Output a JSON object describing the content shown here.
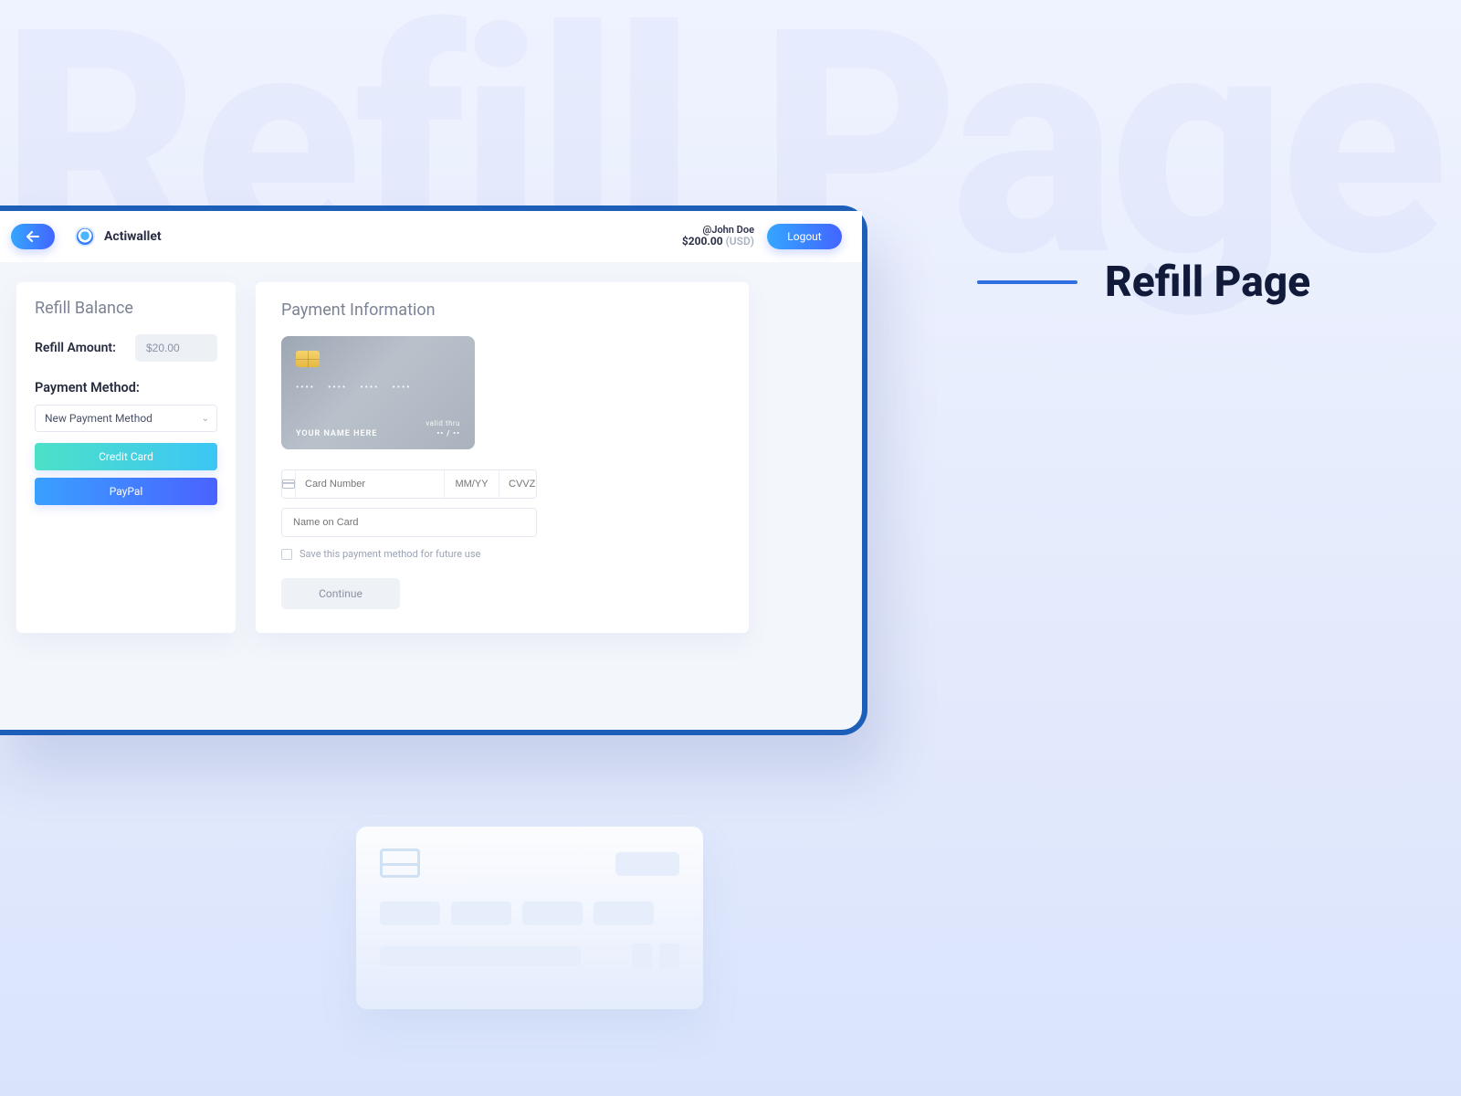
{
  "page": {
    "watermark": "Refill Page",
    "title": "Refill Page"
  },
  "header": {
    "brand": "Actiwallet",
    "user_handle": "@John Doe",
    "balance_amount": "$200.00",
    "balance_currency": "(USD)",
    "logout_label": "Logout"
  },
  "refill": {
    "card_title": "Refill Balance",
    "amount_label": "Refill Amount:",
    "amount_value": "$20.00",
    "method_label": "Payment Method:",
    "select_value": "New Payment Method",
    "credit_card_label": "Credit Card",
    "paypal_label": "PayPal"
  },
  "payment": {
    "card_title": "Payment Information",
    "cc_number_mask": "•••• •••• •••• ••••",
    "cc_name_placeholder": "YOUR NAME HERE",
    "cc_valid_label": "valid thru",
    "cc_valid_value": "•• / ••",
    "card_number_placeholder": "Card Number",
    "expiry_placeholder": "MM/YY",
    "cvv_placeholder": "CVVZ",
    "name_placeholder": "Name on Card",
    "save_label": "Save this payment method for future use",
    "continue_label": "Continue"
  }
}
